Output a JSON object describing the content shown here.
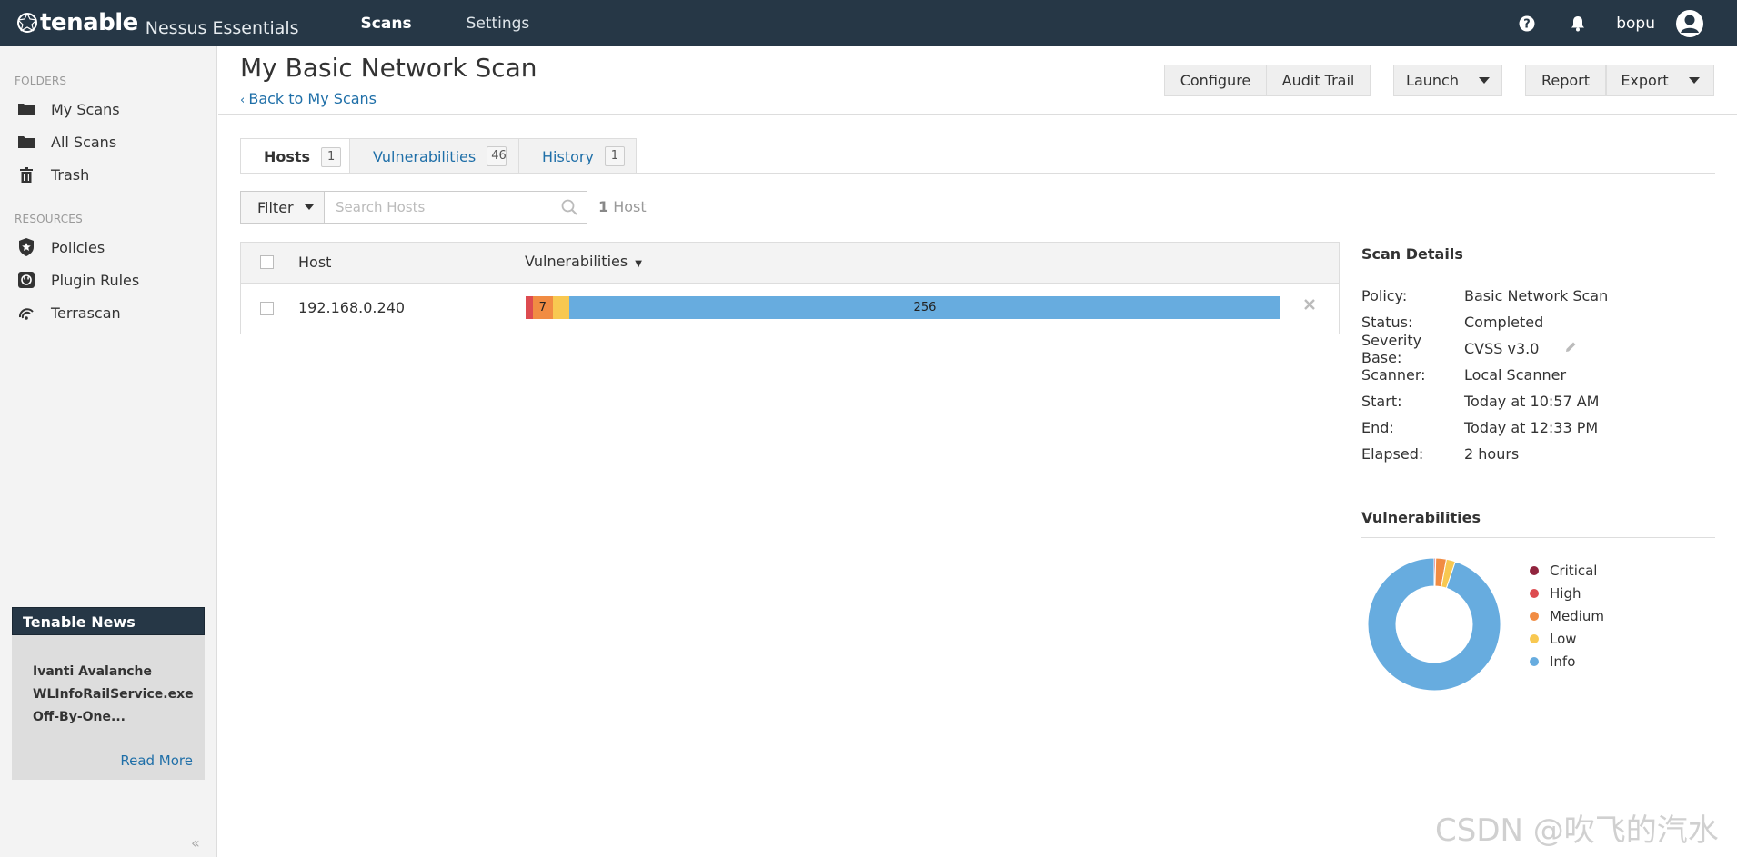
{
  "topbar": {
    "brand": "tenable",
    "product": "Nessus Essentials",
    "nav": [
      {
        "label": "Scans",
        "active": true
      },
      {
        "label": "Settings",
        "active": false
      }
    ],
    "username": "bopu"
  },
  "sidebar": {
    "folders_label": "FOLDERS",
    "folders": [
      {
        "label": "My Scans",
        "icon": "folder-icon"
      },
      {
        "label": "All Scans",
        "icon": "folder-icon"
      },
      {
        "label": "Trash",
        "icon": "trash-icon"
      }
    ],
    "resources_label": "RESOURCES",
    "resources": [
      {
        "label": "Policies",
        "icon": "shield-icon"
      },
      {
        "label": "Plugin Rules",
        "icon": "plugin-icon"
      },
      {
        "label": "Terrascan",
        "icon": "terrascan-icon"
      }
    ],
    "news": {
      "title": "Tenable News",
      "line1": "Ivanti Avalanche",
      "line2": "WLInfoRailService.exe",
      "line3": "Off-By-One...",
      "read_more": "Read More"
    }
  },
  "header": {
    "title": "My Basic Network Scan",
    "back": "Back to My Scans",
    "buttons": {
      "configure": "Configure",
      "audit_trail": "Audit Trail",
      "launch": "Launch",
      "report": "Report",
      "export": "Export"
    }
  },
  "tabs": [
    {
      "label": "Hosts",
      "count": "1",
      "active": true
    },
    {
      "label": "Vulnerabilities",
      "count": "46",
      "active": false
    },
    {
      "label": "History",
      "count": "1",
      "active": false
    }
  ],
  "filter": {
    "label": "Filter",
    "placeholder": "Search Hosts",
    "count_num": "1",
    "count_label": "Host"
  },
  "table": {
    "headers": {
      "host": "Host",
      "vulnerabilities": "Vulnerabilities"
    },
    "rows": [
      {
        "host": "192.168.0.240",
        "bar": {
          "critical": {
            "value": 0,
            "label": ""
          },
          "high": {
            "value": 1,
            "label": ""
          },
          "medium": {
            "value": 7,
            "label": "7"
          },
          "low": {
            "value": 6,
            "label": ""
          },
          "info": {
            "value": 256,
            "label": "256"
          }
        }
      }
    ]
  },
  "scan_details": {
    "title": "Scan Details",
    "items": [
      {
        "key": "Policy:",
        "value": "Basic Network Scan"
      },
      {
        "key": "Status:",
        "value": "Completed"
      },
      {
        "key": "Severity Base:",
        "value": "CVSS v3.0"
      },
      {
        "key": "Scanner:",
        "value": "Local Scanner"
      },
      {
        "key": "Start:",
        "value": "Today at 10:57 AM"
      },
      {
        "key": "End:",
        "value": "Today at 12:33 PM"
      },
      {
        "key": "Elapsed:",
        "value": "2 hours"
      }
    ]
  },
  "vuln_chart": {
    "title": "Vulnerabilities",
    "legend": [
      {
        "label": "Critical",
        "color": "#91243e"
      },
      {
        "label": "High",
        "color": "#dd4b50"
      },
      {
        "label": "Medium",
        "color": "#f18c43"
      },
      {
        "label": "Low",
        "color": "#f8c851"
      },
      {
        "label": "Info",
        "color": "#67acdf"
      }
    ]
  },
  "chart_data": {
    "type": "pie",
    "categories": [
      "Critical",
      "High",
      "Medium",
      "Low",
      "Info"
    ],
    "values": [
      0,
      1,
      7,
      6,
      256
    ]
  },
  "colors": {
    "topbar": "#263746",
    "link": "#1f6fa8",
    "critical": "#91243e",
    "high": "#dd4b50",
    "medium": "#f18c43",
    "low": "#f8c851",
    "info": "#67acdf"
  },
  "watermark": "CSDN @吹飞的汽水"
}
